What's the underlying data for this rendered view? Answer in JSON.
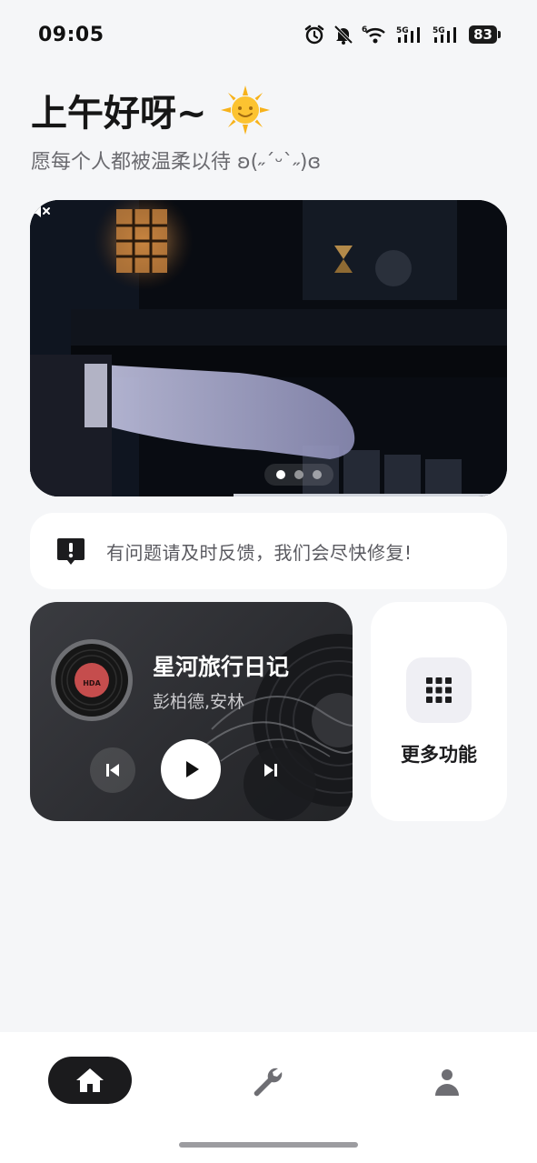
{
  "status_bar": {
    "time": "09:05",
    "network_1": "5G",
    "network_2": "5G",
    "wifi_badge": "6",
    "battery": "83",
    "icons": [
      "alarm-icon",
      "mute-bell-icon",
      "wifi-icon",
      "signal-icon",
      "signal-icon",
      "battery-icon"
    ]
  },
  "greeting": {
    "title": "上午好呀~",
    "subtitle": "愿每个人都被温柔以待 ʚ(˶ˊᵕˋ˶)ɞ"
  },
  "banner": {
    "page_count": 3,
    "active_page": 0,
    "muted": true
  },
  "notice": {
    "text": "有问题请及时反馈，我们会尽快修复!"
  },
  "music": {
    "title": "星河旅行日记",
    "artist": "彭柏德,安林",
    "disc_label": "HDA",
    "playing": false
  },
  "more": {
    "label": "更多功能"
  },
  "nav": {
    "items": [
      {
        "name": "home",
        "icon": "home-icon",
        "active": true
      },
      {
        "name": "tools",
        "icon": "wrench-icon",
        "active": false
      },
      {
        "name": "profile",
        "icon": "person-icon",
        "active": false
      }
    ]
  },
  "colors": {
    "background": "#f5f6f8",
    "card": "#ffffff",
    "music_card": "#2f3034",
    "nav_active": "#1b1b1d"
  }
}
